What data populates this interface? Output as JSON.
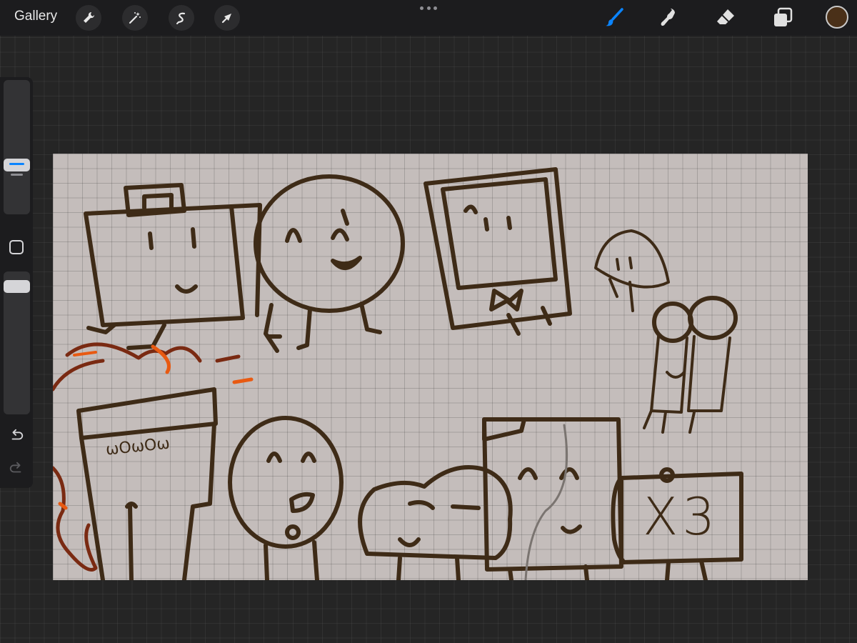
{
  "toolbar": {
    "gallery_label": "Gallery",
    "left_tools": [
      "wrench-icon",
      "magic-wand-icon",
      "selection-icon",
      "transform-arrow-icon"
    ],
    "right_tools": [
      "brush-icon",
      "smudge-icon",
      "eraser-icon",
      "layers-icon"
    ],
    "active_tool": "brush-icon",
    "accent_color": "#0a84ff",
    "current_color": "#4a3018"
  },
  "sidebar": {
    "brush_size": 0.65,
    "brush_opacity": 1.0,
    "undo": "undo-icon",
    "redo": "redo-icon"
  },
  "canvas": {
    "background_color": "#c4bdbb",
    "ink_color": "#3e2b17",
    "fire_colors": [
      "#7a2a12",
      "#e85a12"
    ],
    "sign_text": "X3",
    "cup_text": "ωOωOω"
  }
}
